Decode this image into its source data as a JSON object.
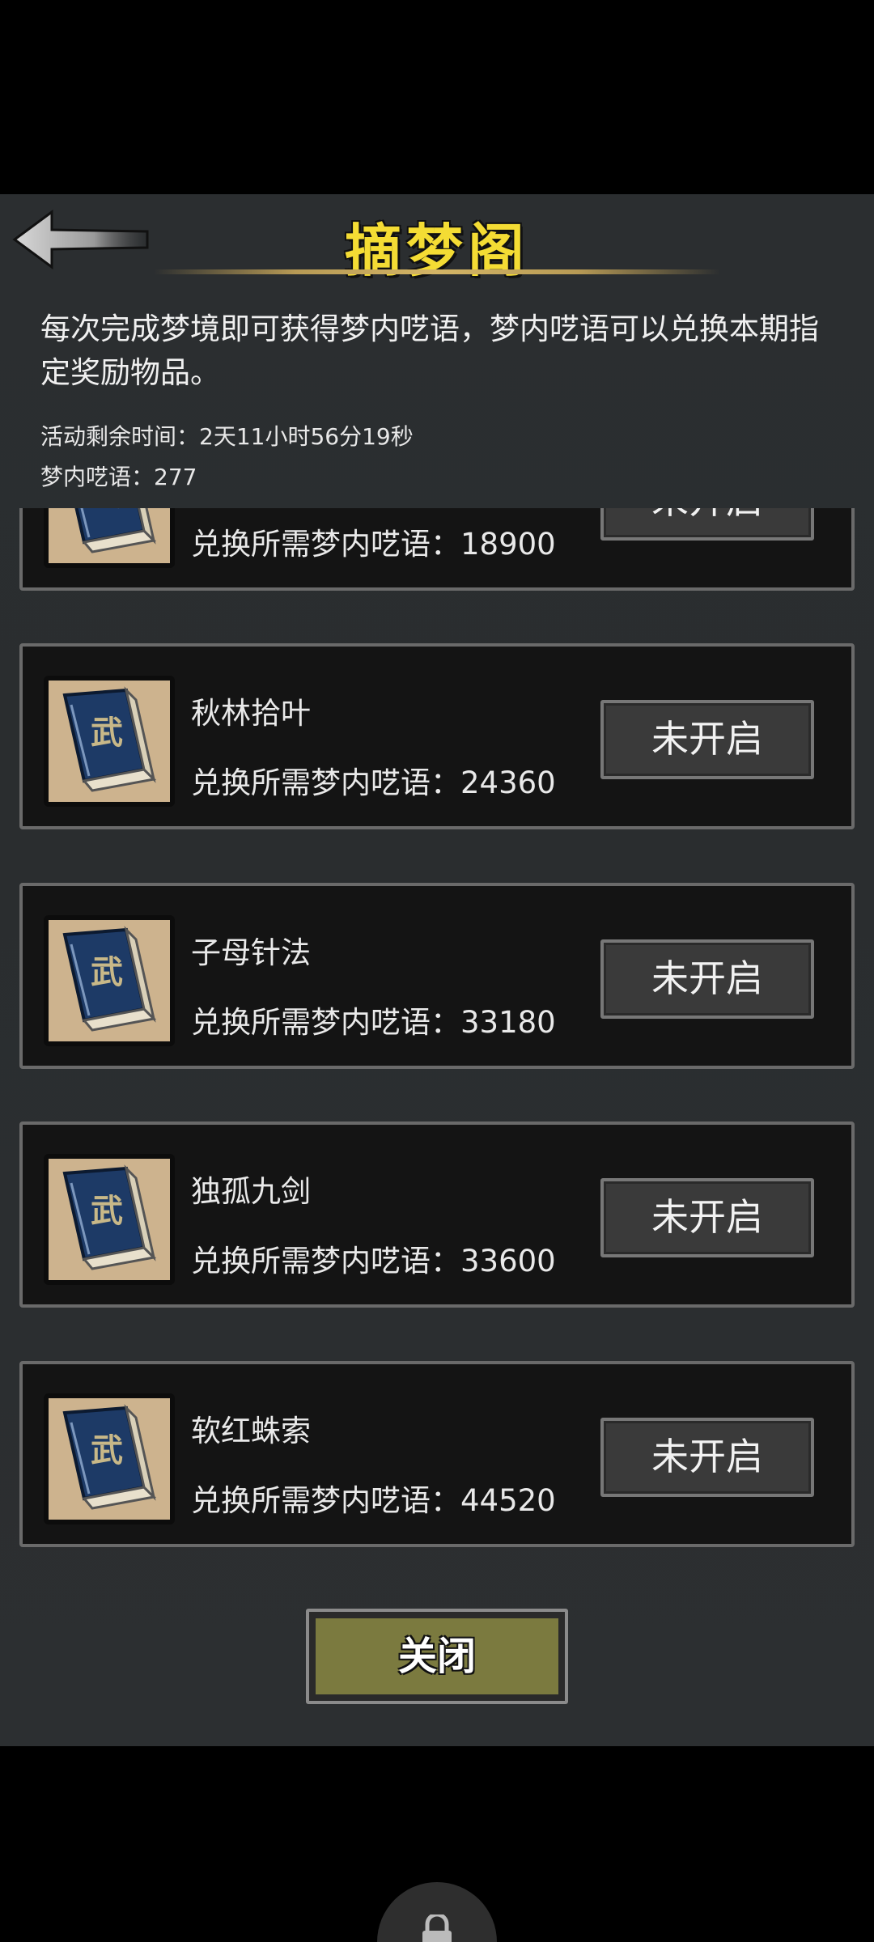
{
  "header": {
    "title": "摘梦阁",
    "back_icon": "back-arrow-icon"
  },
  "info": {
    "description": "每次完成梦境即可获得梦内呓语，梦内呓语可以兑换本期指定奖励物品。",
    "remaining_time": "活动剩余时间：2天11小时56分19秒",
    "dream_words": "梦内呓语：277"
  },
  "items": [
    {
      "name": "",
      "cost": "兑换所需梦内呓语：18900",
      "button": "未开启",
      "icon": "martial-book-icon"
    },
    {
      "name": "秋林拾叶",
      "cost": "兑换所需梦内呓语：24360",
      "button": "未开启",
      "icon": "martial-book-icon"
    },
    {
      "name": "子母针法",
      "cost": "兑换所需梦内呓语：33180",
      "button": "未开启",
      "icon": "martial-book-icon"
    },
    {
      "name": "独孤九剑",
      "cost": "兑换所需梦内呓语：33600",
      "button": "未开启",
      "icon": "martial-book-icon"
    },
    {
      "name": "软红蛛索",
      "cost": "兑换所需梦内呓语：44520",
      "button": "未开启",
      "icon": "martial-book-icon"
    }
  ],
  "book_glyph": "武",
  "close_button": "关闭",
  "colors": {
    "title": "#f4dc34",
    "panel_bg": "#2b2e30",
    "item_bg": "#141414",
    "close_btn": "#7b7a3f",
    "book_cover": "#1d3a66"
  }
}
